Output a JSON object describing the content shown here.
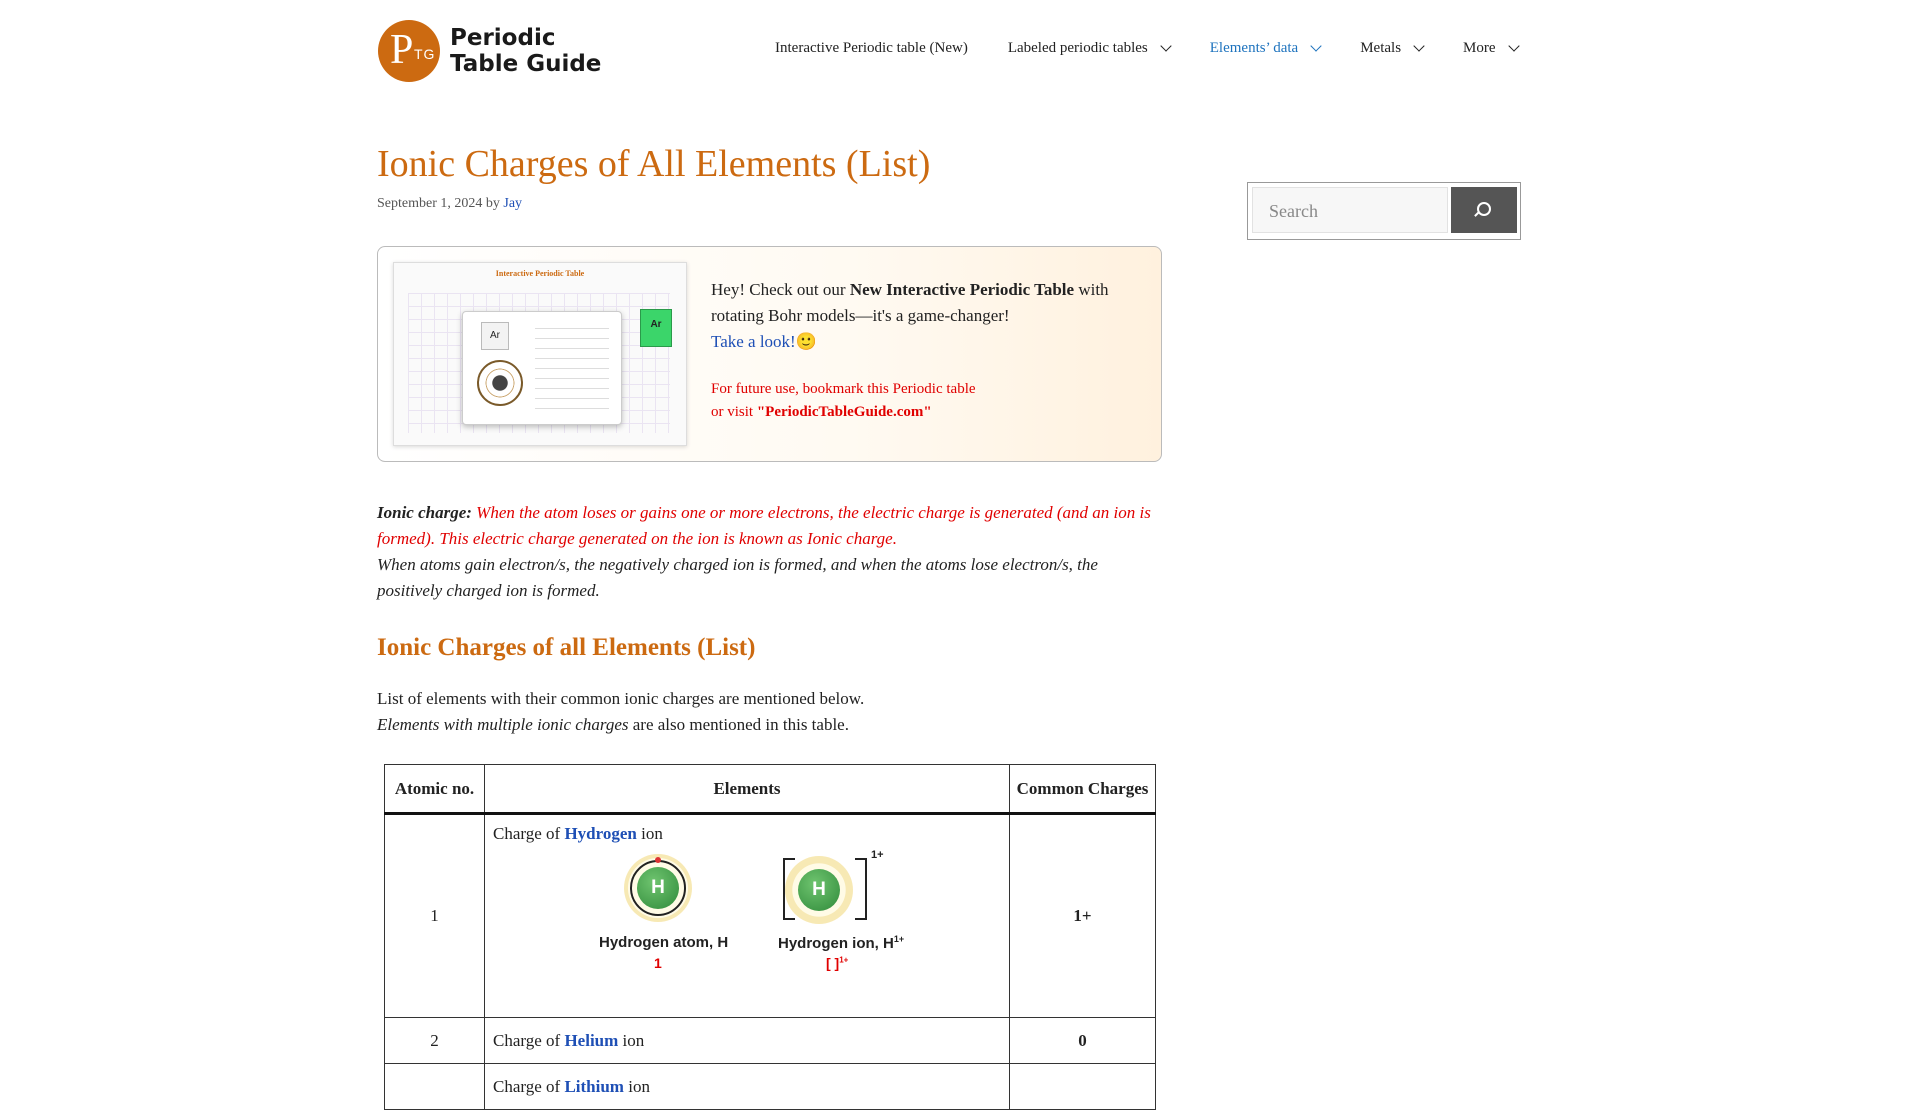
{
  "header": {
    "logo_letter": "P",
    "logo_sub": "TG",
    "logo_text": "Periodic Table Guide",
    "nav": [
      {
        "label": "Interactive Periodic table (New)",
        "dropdown": false
      },
      {
        "label": "Labeled periodic tables",
        "dropdown": true
      },
      {
        "label": "Elements’ data",
        "dropdown": true,
        "active": true
      },
      {
        "label": "Metals",
        "dropdown": true
      },
      {
        "label": "More",
        "dropdown": true
      }
    ]
  },
  "article": {
    "title": "Ionic Charges of All Elements (List)",
    "date": "September 1, 2024",
    "by": "by",
    "author": "Jay"
  },
  "promo": {
    "image_title": "Interactive Periodic Table",
    "image_element": "Ar",
    "text_prefix": "Hey! Check out our ",
    "text_bold": "New Interactive Periodic Table",
    "text_suffix": " with rotating Bohr models—it's a game-changer!",
    "link": "Take a look!🙂",
    "note_line1": "For future use, bookmark this Periodic table",
    "note_line2_prefix": "or visit ",
    "note_line2_bold": "\"PeriodicTableGuide.com\""
  },
  "definition": {
    "term": "Ionic charge:",
    "red_text": " When the atom loses or gains one or more electrons, the electric charge is generated (and an ion is formed). This electric charge generated on the ion is known as Ionic charge.",
    "text": "When atoms gain electron/s, the negatively charged ion is formed, and when the atoms lose electron/s, the positively charged ion is formed."
  },
  "section": {
    "heading": "Ionic Charges of all Elements (List)",
    "intro1": "List of elements with their common ionic charges are mentioned below.",
    "intro2_italic": "Elements with multiple ionic charges",
    "intro2_rest": " are also mentioned in this table."
  },
  "table": {
    "headers": [
      "Atomic no.",
      "Elements",
      "Common Charges"
    ],
    "rows": [
      {
        "num": "1",
        "prefix": "Charge of ",
        "element": "Hydrogen",
        "suffix": " ion",
        "charge": "1+"
      },
      {
        "num": "2",
        "prefix": "Charge of ",
        "element": "Helium",
        "suffix": " ion",
        "charge": "0"
      },
      {
        "num": "",
        "prefix": "Charge of ",
        "element": "Lithium",
        "suffix": " ion",
        "charge": ""
      }
    ],
    "hydrogen_figure": {
      "atom_symbol": "H",
      "ion_symbol": "H",
      "ion_sup": "1+",
      "atom_caption": "Hydrogen atom, H",
      "ion_caption": "Hydrogen ion, H",
      "ion_caption_sup": "1+",
      "atom_note": "1",
      "ion_note": "[ ]",
      "ion_note_sup": "1+"
    }
  },
  "sidebar": {
    "search_placeholder": "Search"
  },
  "colors": {
    "brand": "#cc6a11",
    "link": "#1e4fb5",
    "nav_active": "#1e73be",
    "highlight_red": "#e00000"
  }
}
